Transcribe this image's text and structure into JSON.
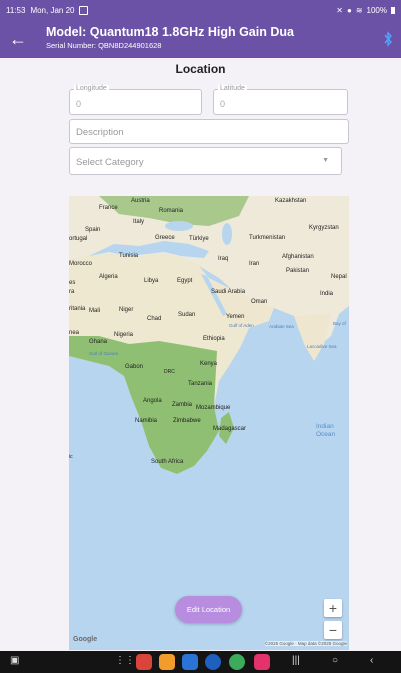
{
  "status_bar": {
    "time": "11:53",
    "date": "Mon, Jan 20",
    "battery": "100%"
  },
  "app_bar": {
    "title": "Model: Quantum18 1.8GHz  High Gain Dua",
    "serial": "Serial Number: QBN8D244901628"
  },
  "page": {
    "title": "Location"
  },
  "form": {
    "longitude": {
      "label": "Longitude",
      "value": "0"
    },
    "latitude": {
      "label": "Latitude",
      "value": "0"
    },
    "description": {
      "placeholder": "Description"
    },
    "category": {
      "placeholder": "Select Category"
    }
  },
  "map": {
    "labels": {
      "france": "France",
      "austria": "Austria",
      "romania": "Romania",
      "kazakhstan": "Kazakhstan",
      "italy": "Italy",
      "spain": "Spain",
      "portugal": "ortugal",
      "greece": "Greece",
      "turkiye": "Türkiye",
      "kyrgyzstan": "Kyrgyzstan",
      "turkmenistan": "Turkmenistan",
      "tunisia": "Tunisia",
      "iraq": "Iraq",
      "iran": "Iran",
      "afghanistan": "Afghanistan",
      "morocco": "Morocco",
      "pakistan": "Pakistan",
      "algeria": "Algeria",
      "libya": "Libya",
      "egypt": "Egypt",
      "saudi": "Saudi Arabia",
      "nepal": "Nepal",
      "india": "India",
      "oman": "Oman",
      "mauritania": "ritania",
      "mali": "Mali",
      "niger": "Niger",
      "chad": "Chad",
      "sudan": "Sudan",
      "yemen": "Yemen",
      "gulf_aden": "Gulf of Aden",
      "arabian_sea": "Arabian Sea",
      "bay_of": "Bay of",
      "nigeria": "Nigeria",
      "ghana": "Ghana",
      "guinea": "nea",
      "ethiopia": "Ethiopia",
      "laccadive": "Laccadive Sea",
      "gulf_guinea": "Gulf of Guinea",
      "gabon": "Gabon",
      "drc": "DRC",
      "kenya": "Kenya",
      "tanzania": "Tanzania",
      "angola": "Angola",
      "zambia": "Zambia",
      "mozambique": "Mozambique",
      "namibia": "Namibia",
      "zimbabwe": "Zimbabwe",
      "madagascar": "Madagascar",
      "south_africa": "South Africa",
      "indian_ocean_1": "Indian",
      "indian_ocean_2": "Ocean",
      "es": "es",
      "ra": "ra",
      "ic": "ic"
    },
    "google": "Google",
    "attribution": "©2025 Google · Map data ©2025 Google",
    "zoom_in": "+",
    "zoom_out": "−",
    "edit_button": "Edit Location"
  },
  "colors": {
    "primary": "#6b52a6",
    "accent_button": "#b88de0",
    "water": "#b7d5ef",
    "land": "#f2efe4",
    "forest": "#7fb56a"
  }
}
